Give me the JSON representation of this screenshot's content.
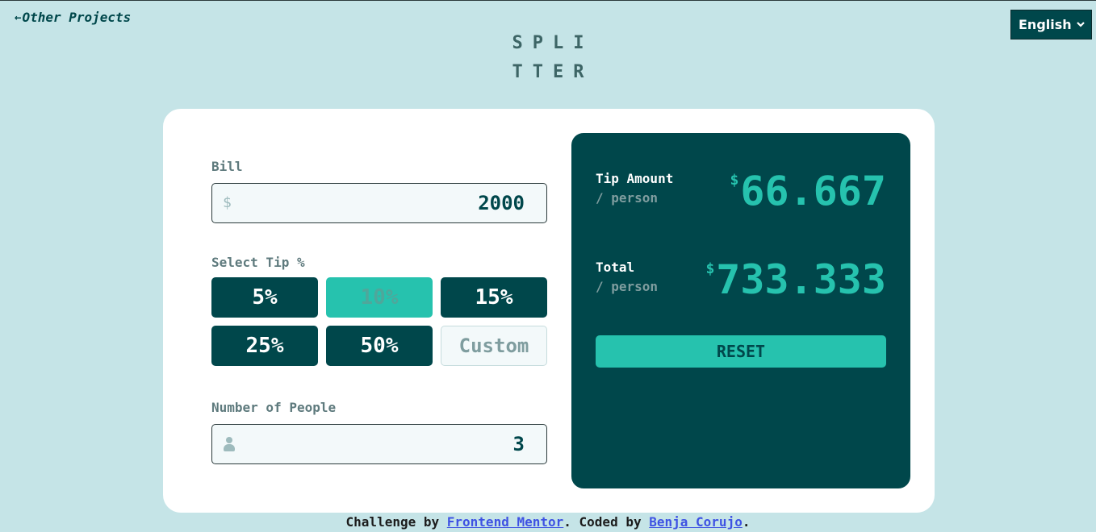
{
  "header": {
    "back_arrow": "←",
    "back_link": "Other Projects",
    "language": "English",
    "logo_line1": "SPLI",
    "logo_line2": "TTER"
  },
  "form": {
    "bill_label": "Bill",
    "bill_prefix": "$",
    "bill_value": "2000",
    "tip_label": "Select Tip %",
    "tips": [
      "5%",
      "10%",
      "15%",
      "25%",
      "50%"
    ],
    "selected_tip": "10%",
    "custom_placeholder": "Custom",
    "people_label": "Number of People",
    "people_value": "3"
  },
  "result": {
    "tip_label": "Tip Amount",
    "tip_sub": "/ person",
    "tip_currency": "$",
    "tip_value": "66.667",
    "total_label": "Total",
    "total_sub": "/ person",
    "total_currency": "$",
    "total_value": "733.333",
    "reset_label": "RESET"
  },
  "footer": {
    "prefix": "Challenge by ",
    "link1": "Frontend Mentor",
    "middle": ". Coded by ",
    "link2": "Benja Corujo",
    "suffix": "."
  },
  "colors": {
    "background": "#c5e4e7",
    "dark_cyan": "#00474b",
    "strong_cyan": "#26c2ae",
    "link_blue": "#3e52e3"
  },
  "icons": {
    "back": "left-arrow-icon",
    "language": "chevron-down-icon",
    "people": "person-icon"
  }
}
